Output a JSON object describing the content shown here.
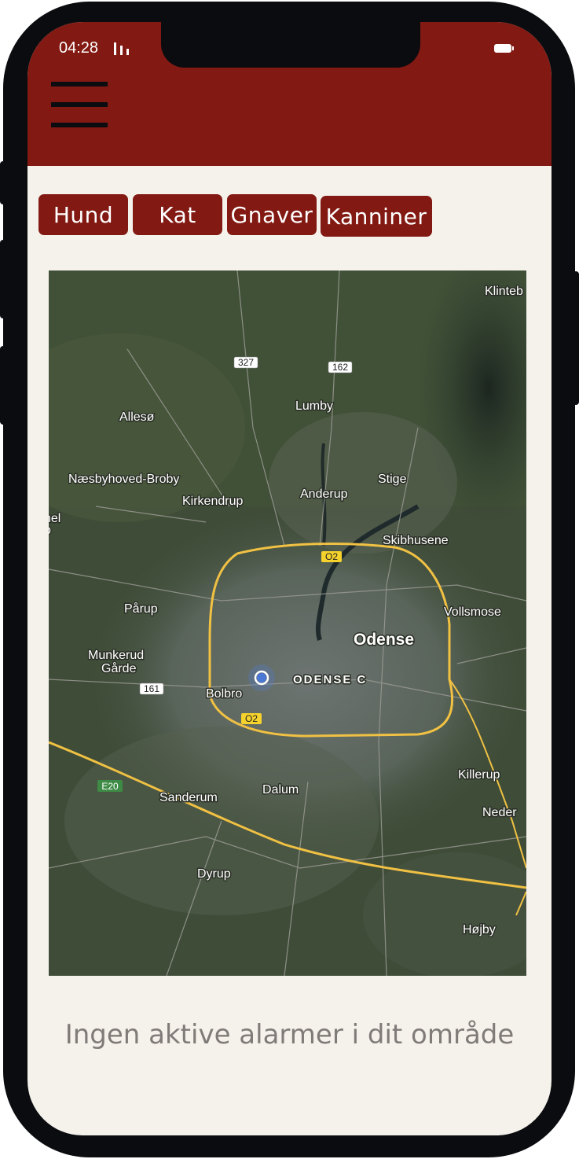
{
  "status": {
    "time": "04:28"
  },
  "filters": [
    {
      "label": "Hund"
    },
    {
      "label": "Kat"
    },
    {
      "label": "Gnaver"
    },
    {
      "label": "Kanniner"
    }
  ],
  "map": {
    "places": {
      "klinteb": "Klinteb",
      "allesoe": "Allesø",
      "lumby": "Lumby",
      "naesbyhoved": "Næsbyhoved-Broby",
      "kirkendrup": "Kirkendrup",
      "anderup": "Anderup",
      "stige": "Stige",
      "skibhusene": "Skibhusene",
      "nel": "nel",
      "p": "p",
      "paarup": "Pårup",
      "vollsmose": "Vollsmose",
      "odense": "Odense",
      "munkerud": "Munkerud",
      "gaarde": "Gårde",
      "odense_c": "ODENSE C",
      "bolbro": "Bolbro",
      "killerup": "Killerup",
      "sanderum": "Sanderum",
      "dalum": "Dalum",
      "neder": "Neder",
      "dyrup": "Dyrup",
      "hoejby": "Højby"
    },
    "roads": {
      "r327": "327",
      "r162": "162",
      "r161": "161",
      "o2a": "O2",
      "o2b": "O2",
      "e20": "E20"
    },
    "location_marker": "current-location"
  },
  "message": "Ingen aktive alarmer i dit område",
  "colors": {
    "brand": "#821912",
    "background": "#f5f2ec",
    "message": "#807b78"
  }
}
